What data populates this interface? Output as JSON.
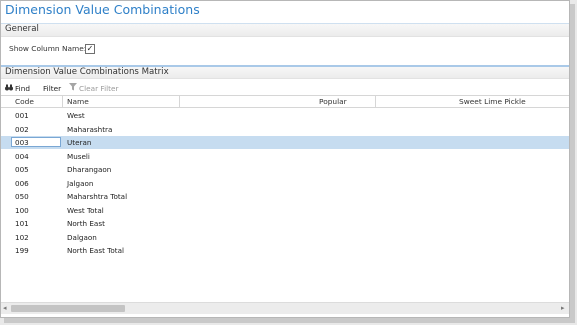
{
  "page": {
    "title": "Dimension Value Combinations"
  },
  "general": {
    "heading": "General",
    "show_column_name_label": "Show Column Name:",
    "show_column_name_checked": true,
    "checkmark": "✓"
  },
  "matrix": {
    "heading": "Dimension Value Combinations Matrix"
  },
  "toolbar": {
    "find": "Find",
    "filter": "Filter",
    "clear_filter": "Clear Filter"
  },
  "columns": {
    "code": "Code",
    "name": "Name",
    "col1": "Popular",
    "col2": "Sweet Lime Pickle"
  },
  "rows": [
    {
      "code": "001",
      "name": "West"
    },
    {
      "code": "002",
      "name": "Maharashtra"
    },
    {
      "code": "003",
      "name": "Uteran",
      "selected": true
    },
    {
      "code": "004",
      "name": "Museli"
    },
    {
      "code": "005",
      "name": "Dharangaon"
    },
    {
      "code": "006",
      "name": "Jalgaon"
    },
    {
      "code": "050",
      "name": "Maharshtra Total"
    },
    {
      "code": "100",
      "name": "West Total"
    },
    {
      "code": "101",
      "name": "North East"
    },
    {
      "code": "102",
      "name": "Dalgaon"
    },
    {
      "code": "199",
      "name": "North East Total"
    }
  ],
  "scrollbar": {
    "left_arrow": "◂",
    "right_arrow": "▸"
  },
  "colors": {
    "title_blue": "#2f80c8",
    "selection": "#c6dcf0"
  }
}
